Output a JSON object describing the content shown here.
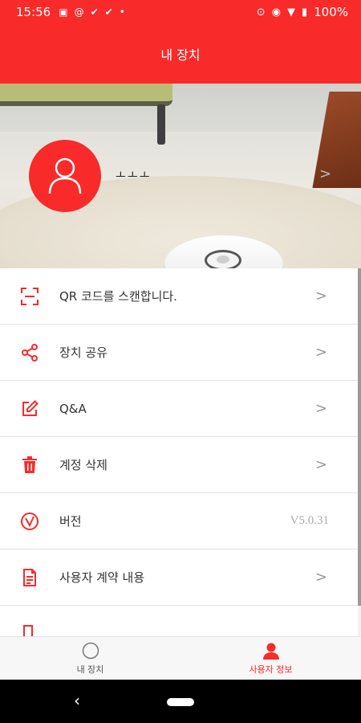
{
  "status_bar": {
    "time": "15:56",
    "battery": "100%"
  },
  "header": {
    "title": "내 장치"
  },
  "profile": {
    "name": "ㅗㅗㅗ"
  },
  "menu": [
    {
      "label": "QR 코드를 스캔합니다.",
      "icon": "qr-scan-icon",
      "chevron": ">"
    },
    {
      "label": "장치 공유",
      "icon": "share-icon",
      "chevron": ">"
    },
    {
      "label": "Q&A",
      "icon": "edit-icon",
      "chevron": ">"
    },
    {
      "label": "계정 삭제",
      "icon": "trash-icon",
      "chevron": ">"
    },
    {
      "label": "버전",
      "icon": "version-icon",
      "value": "V5.0.31"
    },
    {
      "label": "사용자 계약 내용",
      "icon": "document-icon",
      "chevron": ">"
    }
  ],
  "bottom_nav": [
    {
      "label": "내 장치",
      "icon": "circle-icon",
      "active": false
    },
    {
      "label": "사용자 정보",
      "icon": "person-icon",
      "active": true
    }
  ],
  "accent_color": "#f82a2a"
}
